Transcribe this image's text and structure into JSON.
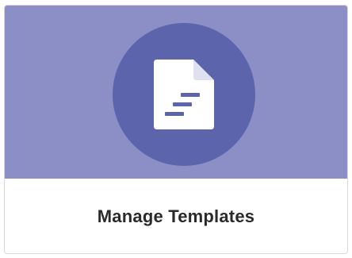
{
  "card": {
    "title": "Manage Templates",
    "icon": "document-icon"
  },
  "colors": {
    "banner": "#8b8fc6",
    "circle": "#5c65ac",
    "icon": "#ffffff",
    "icon_lines": "#5c65ac",
    "text": "#2a2a2a"
  }
}
